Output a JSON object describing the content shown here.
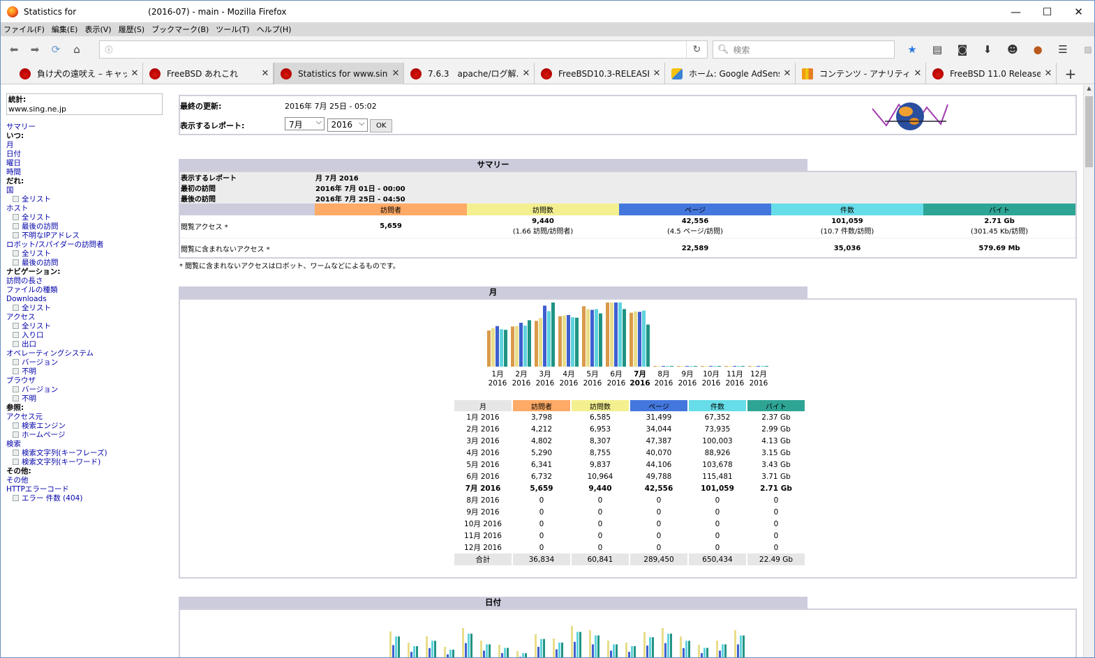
{
  "window": {
    "title": "Statistics for                           (2016-07) - main - Mozilla Firefox",
    "minimize": "—",
    "maximize": "☐",
    "close": "✕"
  },
  "menu": [
    "ファイル(F)",
    "編集(E)",
    "表示(V)",
    "履歴(S)",
    "ブックマーク(B)",
    "ツール(T)",
    "ヘルプ(H)"
  ],
  "nav": {
    "url": "",
    "search_placeholder": "検索"
  },
  "tabs": [
    {
      "label": "負け犬の遠吠え – キャッ...",
      "icon": "freebsd-icon"
    },
    {
      "label": "FreeBSD あれこれ",
      "icon": "freebsd-icon"
    },
    {
      "label": "Statistics for www.sin...",
      "icon": "freebsd-icon",
      "active": true
    },
    {
      "label": "7.6.3　apache/ログ解...",
      "icon": "freebsd-icon"
    },
    {
      "label": "FreeBSD10.3-RELEASE",
      "icon": "freebsd-icon"
    },
    {
      "label": "ホーム: Google AdSense",
      "icon": "adsense-icon"
    },
    {
      "label": "コンテンツ - アナリティクス",
      "icon": "analytics-icon"
    },
    {
      "label": "FreeBSD 11.0 Release ...",
      "icon": "freebsd-icon"
    }
  ],
  "sidebar": {
    "title": "統計:",
    "site": "www.sing.ne.jp",
    "items": [
      {
        "t": "サマリー",
        "k": "link"
      },
      {
        "t": "いつ:",
        "k": "head"
      },
      {
        "t": "月",
        "k": "link"
      },
      {
        "t": "日付",
        "k": "link"
      },
      {
        "t": "曜日",
        "k": "link"
      },
      {
        "t": "時間",
        "k": "link"
      },
      {
        "t": "だれ:",
        "k": "head"
      },
      {
        "t": "国",
        "k": "link"
      },
      {
        "t": "全リスト",
        "k": "sub"
      },
      {
        "t": "ホスト",
        "k": "link"
      },
      {
        "t": "全リスト",
        "k": "sub"
      },
      {
        "t": "最後の訪問",
        "k": "sub"
      },
      {
        "t": "不明なIPアドレス",
        "k": "sub"
      },
      {
        "t": "ロボット/スパイダーの訪問者",
        "k": "link"
      },
      {
        "t": "全リスト",
        "k": "sub"
      },
      {
        "t": "最後の訪問",
        "k": "sub"
      },
      {
        "t": "ナビゲーション:",
        "k": "head"
      },
      {
        "t": "訪問の長さ",
        "k": "link"
      },
      {
        "t": "ファイルの種類",
        "k": "link"
      },
      {
        "t": "Downloads",
        "k": "link"
      },
      {
        "t": "全リスト",
        "k": "sub"
      },
      {
        "t": "アクセス",
        "k": "link"
      },
      {
        "t": "全リスト",
        "k": "sub"
      },
      {
        "t": "入り口",
        "k": "sub"
      },
      {
        "t": "出口",
        "k": "sub"
      },
      {
        "t": "オペレーティングシステム",
        "k": "link"
      },
      {
        "t": "バージョン",
        "k": "sub"
      },
      {
        "t": "不明",
        "k": "sub"
      },
      {
        "t": "ブラウザ",
        "k": "link"
      },
      {
        "t": "バージョン",
        "k": "sub"
      },
      {
        "t": "不明",
        "k": "sub"
      },
      {
        "t": "参照:",
        "k": "head"
      },
      {
        "t": "アクセス元",
        "k": "link"
      },
      {
        "t": "検索エンジン",
        "k": "sub"
      },
      {
        "t": "ホームページ",
        "k": "sub"
      },
      {
        "t": "検索",
        "k": "link"
      },
      {
        "t": "検索文字列(キーフレーズ)",
        "k": "sub"
      },
      {
        "t": "検索文字列(キーワード)",
        "k": "sub"
      },
      {
        "t": "その他:",
        "k": "head"
      },
      {
        "t": "その他",
        "k": "link"
      },
      {
        "t": "HTTPエラーコード",
        "k": "link"
      },
      {
        "t": "エラー 件数 (404)",
        "k": "sub"
      }
    ]
  },
  "update": {
    "label": "最終の更新:",
    "value": "2016年 7月 25日 - 05:02",
    "report_label": "表示するレポート:",
    "month": "7月",
    "year": "2016",
    "ok": "OK"
  },
  "summary": {
    "title": "サマリー",
    "report_label": "表示するレポート",
    "report_value": "月 7月 2016",
    "first_label": "最初の訪問",
    "first_value": "2016年 7月 01日 - 00:00",
    "last_label": "最後の訪問",
    "last_value": "2016年 7月 25日 - 04:50",
    "cols": [
      "訪問者",
      "訪問数",
      "ページ",
      "件数",
      "バイト"
    ],
    "colors": [
      "#ffaa66",
      "#f4f090",
      "#4477dd",
      "#66dde8",
      "#2ea495"
    ],
    "view_label": "閲覧アクセス *",
    "view_values": [
      "5,659",
      "9,440",
      "42,556",
      "101,059",
      "2.71 Gb"
    ],
    "view_sub": [
      "",
      "(1.66 訪問/訪問者)",
      "(4.5 ページ/訪問)",
      "(10.7 件数/訪問)",
      "(301.45 Kb/訪問)"
    ],
    "nonview_label": "閲覧に含まれないアクセス *",
    "nonview_values": [
      "",
      "",
      "22,589",
      "35,036",
      "579.69 Mb"
    ],
    "note": "* 閲覧に含まれないアクセスはロボット、ワームなどによるものです。"
  },
  "month_section": {
    "title": "月",
    "date_title": "日付"
  },
  "month_table": {
    "headers": [
      "月",
      "訪問者",
      "訪問数",
      "ページ",
      "件数",
      "バイト"
    ],
    "rows": [
      [
        "1月 2016",
        "3,798",
        "6,585",
        "31,499",
        "67,352",
        "2.37 Gb"
      ],
      [
        "2月 2016",
        "4,212",
        "6,953",
        "34,044",
        "73,935",
        "2.99 Gb"
      ],
      [
        "3月 2016",
        "4,802",
        "8,307",
        "47,387",
        "100,003",
        "4.13 Gb"
      ],
      [
        "4月 2016",
        "5,290",
        "8,755",
        "40,070",
        "88,926",
        "3.15 Gb"
      ],
      [
        "5月 2016",
        "6,341",
        "9,837",
        "44,106",
        "103,678",
        "3.43 Gb"
      ],
      [
        "6月 2016",
        "6,732",
        "10,964",
        "49,788",
        "115,481",
        "3.71 Gb"
      ],
      [
        "7月 2016",
        "5,659",
        "9,440",
        "42,556",
        "101,059",
        "2.71 Gb"
      ],
      [
        "8月 2016",
        "0",
        "0",
        "0",
        "0",
        "0"
      ],
      [
        "9月 2016",
        "0",
        "0",
        "0",
        "0",
        "0"
      ],
      [
        "10月 2016",
        "0",
        "0",
        "0",
        "0",
        "0"
      ],
      [
        "11月 2016",
        "0",
        "0",
        "0",
        "0",
        "0"
      ],
      [
        "12月 2016",
        "0",
        "0",
        "0",
        "0",
        "0"
      ]
    ],
    "total": [
      "合計",
      "36,834",
      "60,841",
      "289,450",
      "650,434",
      "22.49 Gb"
    ]
  },
  "chart_data": {
    "type": "bar",
    "categories": [
      "1月",
      "2月",
      "3月",
      "4月",
      "5月",
      "6月",
      "7月",
      "8月",
      "9月",
      "10月",
      "11月",
      "12月"
    ],
    "category_year": "2016",
    "series": [
      {
        "name": "訪問者",
        "color": "#d99a4a",
        "values": [
          3798,
          4212,
          4802,
          5290,
          6341,
          6732,
          5659,
          0,
          0,
          0,
          0,
          0
        ]
      },
      {
        "name": "訪問数",
        "color": "#e8dd8a",
        "values": [
          6585,
          6953,
          8307,
          8755,
          9837,
          10964,
          9440,
          0,
          0,
          0,
          0,
          0
        ]
      },
      {
        "name": "ページ",
        "color": "#3f5fcf",
        "values": [
          31499,
          34044,
          47387,
          40070,
          44106,
          49788,
          42556,
          0,
          0,
          0,
          0,
          0
        ]
      },
      {
        "name": "件数",
        "color": "#5fd3dd",
        "values": [
          67352,
          73935,
          100003,
          88926,
          103678,
          115481,
          101059,
          0,
          0,
          0,
          0,
          0
        ]
      },
      {
        "name": "バイト",
        "color": "#1f9483",
        "values": [
          2.37,
          2.99,
          4.13,
          3.15,
          3.43,
          3.71,
          2.71,
          0,
          0,
          0,
          0,
          0
        ]
      }
    ]
  }
}
